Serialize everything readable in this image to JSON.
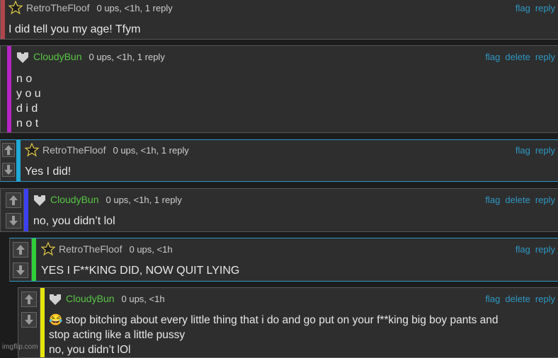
{
  "comments": [
    {
      "username": "RetroTheFloof",
      "meta": "0 ups, <1h, 1 reply",
      "actions": {
        "flag": "flag",
        "reply": "reply"
      },
      "lines": [
        "I did tell you my age! Tfym"
      ],
      "bar_color": "#b0464c"
    },
    {
      "username": "CloudyBun",
      "meta": "0 ups, <1h, 1 reply",
      "actions": {
        "flag": "flag",
        "delete": "delete",
        "reply": "reply"
      },
      "lines": [
        "n o",
        "y o u",
        "d i d",
        "n o t"
      ],
      "bar_color": "#b525c4"
    },
    {
      "username": "RetroTheFloof",
      "meta": "0 ups, <1h, 1 reply",
      "actions": {
        "flag": "flag",
        "reply": "reply"
      },
      "lines": [
        "Yes I did!"
      ],
      "bar_color": "#1ea9d6"
    },
    {
      "username": "CloudyBun",
      "meta": "0 ups, <1h, 1 reply",
      "actions": {
        "flag": "flag",
        "delete": "delete",
        "reply": "reply"
      },
      "lines": [
        "no, you didn’t lol"
      ],
      "bar_color": "#3b3ff0"
    },
    {
      "username": "RetroTheFloof",
      "meta": "0 ups, <1h",
      "actions": {
        "flag": "flag",
        "reply": "reply"
      },
      "lines": [
        "YES I F**KING DID, NOW QUIT LYING"
      ],
      "bar_color": "#2fd03a"
    },
    {
      "username": "CloudyBun",
      "meta": "0 ups, <1h",
      "actions": {
        "flag": "flag",
        "delete": "delete",
        "reply": "reply"
      },
      "lines": [
        "😂 stop bitching about every little thing that i do and go put on your f**king big boy pants and",
        "stop acting like a little pussy",
        "no, you didn’t lOl"
      ],
      "bar_color": "#e4e40f"
    }
  ],
  "watermark": "imgflip.com",
  "colors": {
    "link": "#2f98c4",
    "username_cloudy": "#58c545",
    "username_retro": "#bdbdbd"
  }
}
